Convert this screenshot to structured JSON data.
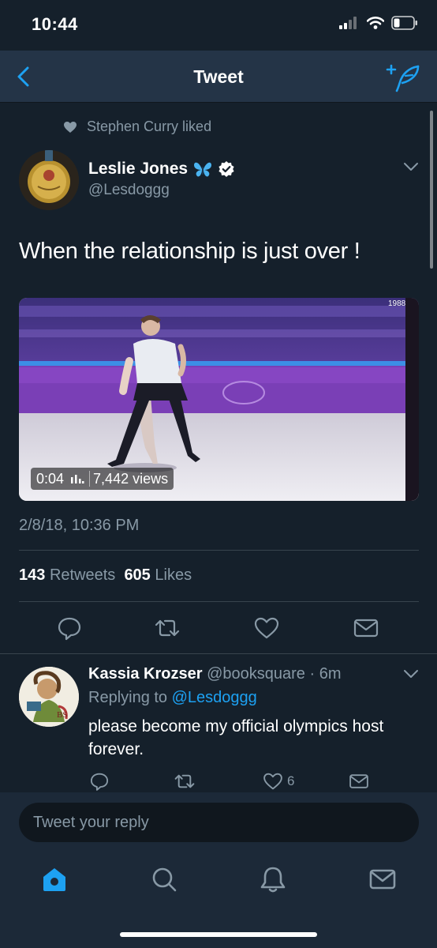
{
  "status_bar": {
    "time": "10:44"
  },
  "nav": {
    "title": "Tweet"
  },
  "social_context": {
    "text": "Stephen Curry liked"
  },
  "tweet": {
    "author_name": "Leslie Jones",
    "author_handle": "@Lesdoggg",
    "text": "When the relationship is just over !",
    "video": {
      "duration": "0:04",
      "views": "7,442 views"
    },
    "date": "2/8/18, 10:36 PM",
    "retweets_count": "143",
    "retweets_label": "Retweets",
    "likes_count": "605",
    "likes_label": "Likes"
  },
  "reply": {
    "author_name": "Kassia Krozser",
    "author_handle": "@booksquare",
    "time": "· 6m",
    "replying_prefix": "Replying to",
    "replying_handle": "@Lesdoggg",
    "text": "please become my official olympics host forever.",
    "likes_count": "6"
  },
  "composer": {
    "placeholder": "Tweet your reply"
  },
  "tab_bar": [
    "home-icon",
    "search-icon",
    "notifications-icon",
    "messages-icon"
  ],
  "colors": {
    "background": "#15202b",
    "nav": "#243447",
    "accent": "#1da1f2",
    "muted": "#8899a6",
    "divider": "#38444d"
  }
}
